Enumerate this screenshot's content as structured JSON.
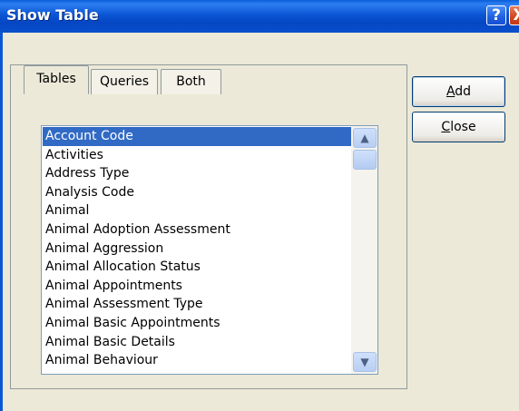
{
  "window": {
    "title": "Show Table",
    "help_icon": "?",
    "close_icon": "X"
  },
  "tabs": [
    {
      "label": "Tables",
      "active": true
    },
    {
      "label": "Queries",
      "active": false
    },
    {
      "label": "Both",
      "active": false
    }
  ],
  "buttons": {
    "add": {
      "accel": "A",
      "rest": "dd"
    },
    "close": {
      "accel": "C",
      "rest": "lose"
    }
  },
  "list": {
    "selected_index": 0,
    "items": [
      "Account Code",
      "Activities",
      "Address Type",
      "Analysis Code",
      "Animal",
      "Animal Adoption Assessment",
      "Animal Aggression",
      "Animal Allocation Status",
      "Animal Appointments",
      "Animal Assessment Type",
      "Animal Basic Appointments",
      "Animal Basic Details",
      "Animal Behaviour"
    ]
  },
  "scrollbar": {
    "up_arrow": "▲",
    "down_arrow": "▼"
  },
  "colors": {
    "titlebar": "#0b56d4",
    "selection": "#316ac5",
    "dialog_face": "#ece9d8"
  }
}
